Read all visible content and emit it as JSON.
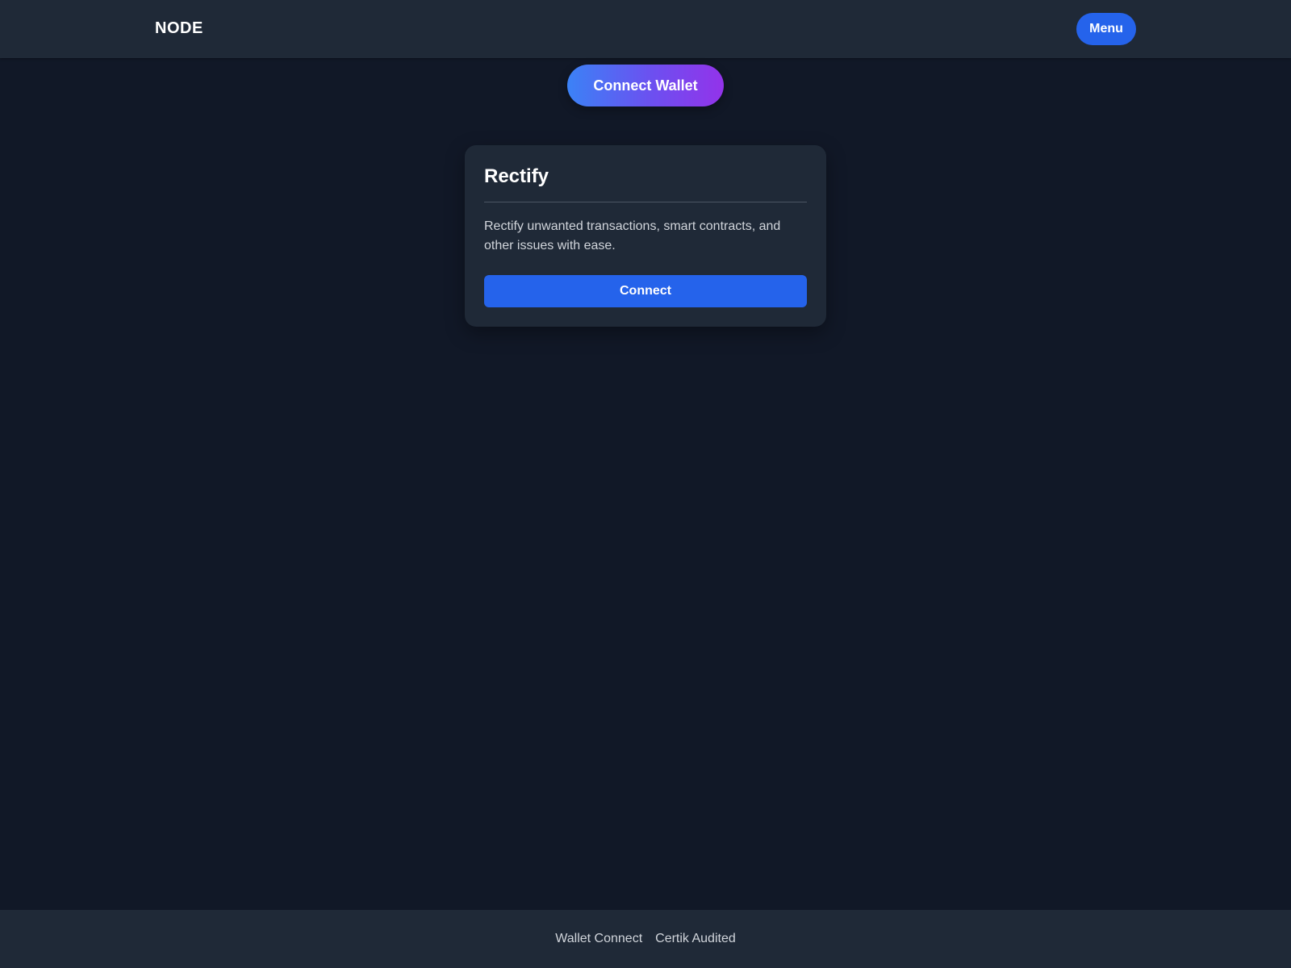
{
  "header": {
    "brand": "NODE",
    "menu_label": "Menu"
  },
  "hero": {
    "connect_wallet_label": "Connect Wallet"
  },
  "card": {
    "title": "Rectify",
    "description": "Rectify unwanted transactions, smart contracts, and other issues with ease.",
    "button_label": "Connect"
  },
  "footer": {
    "links": [
      {
        "label": "Wallet Connect"
      },
      {
        "label": "Certik Audited"
      }
    ]
  },
  "colors": {
    "background": "#111827",
    "surface": "#1f2937",
    "primary": "#2563eb",
    "gradient_start": "#3b82f6",
    "gradient_end": "#9333ea",
    "muted_text": "#d1d5db"
  }
}
